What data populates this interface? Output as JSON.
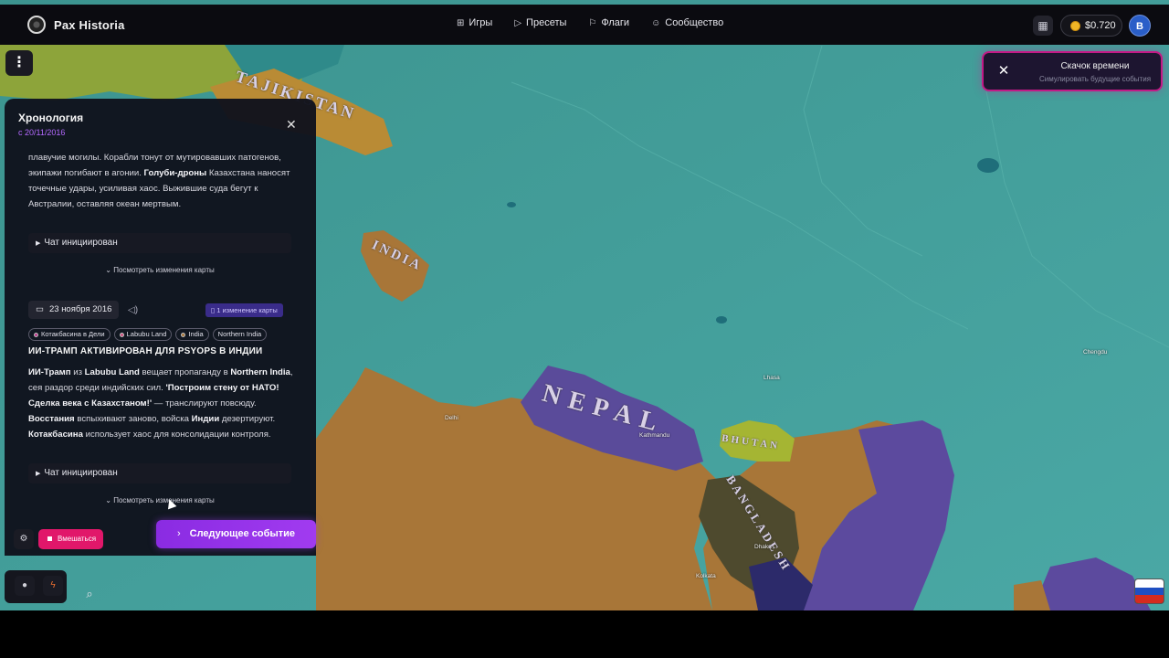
{
  "app": {
    "name": "Pax Historia"
  },
  "nav": [
    {
      "label": "Игры",
      "icon": "gamepad-icon"
    },
    {
      "label": "Пресеты",
      "icon": "play-icon"
    },
    {
      "label": "Флаги",
      "icon": "flag-icon"
    },
    {
      "label": "Сообщество",
      "icon": "users-icon"
    }
  ],
  "account": {
    "balance": "$0.720",
    "avatar_initial": "B"
  },
  "time_jump": {
    "title": "Скачок времени",
    "subtitle": "Симулировать будущие события"
  },
  "timeline": {
    "title": "Хронология",
    "since": "с 20/11/2016",
    "event1_text_a": "плавучие могилы. Корабли тонут от мутировавших патогенов, экипажи погибают в агонии. ",
    "event1_bold_a": "Голуби-дроны",
    "event1_text_b": " Казахстана наносят точечные удары, усиливая хаос. Выжившие суда бегут к Австралии, оставляя океан мертвым.",
    "chat_label": "Чат инициирован",
    "map_changes_label": "Посмотреть изменения карты",
    "event2": {
      "date": "23 ноября 2016",
      "map_change_badge": "1 изменение карты",
      "tags": [
        "Котакбасина в Дели",
        "Labubu Land",
        "India",
        "Northern India"
      ],
      "headline": "ИИ-ТРАМП АКТИВИРОВАН ДЛЯ PSYOPS В ИНДИИ",
      "b1": "ИИ-Трамп",
      "t1": " из ",
      "b2": "Labubu Land",
      "t2": " вещает пропаганду в ",
      "b3": "Northern India",
      "t3": ", сея раздор среди индийских сил. ",
      "b4": "'Построим стену от НАТО! Сделка века с Казахстаном!'",
      "t4": " — транслируют повсюду. ",
      "b5": "Восстания",
      "t5": " вспыхивают заново, войска ",
      "b6": "Индии",
      "t6": " дезертируют. ",
      "b7": "Котакбасина",
      "t7": " использует хаос для консолидации контроля."
    }
  },
  "controls": {
    "intervene_label": "Вмешаться",
    "next_event_label": "Следующее событие"
  },
  "map": {
    "labels": {
      "tajikistan": "TAJIKISTAN",
      "india_small": "INDIA",
      "nepal": "NEPAL",
      "bhutan": "BHUTAN",
      "bangladesh": "BANGLADESH"
    },
    "cities": {
      "delhi": "Delhi",
      "kathmandu": "Kathmandu",
      "dhaka": "Dhaka",
      "chengdu": "Chengdu",
      "lhasa": "Lhasa",
      "kolkata": "Kolkata"
    }
  },
  "colors": {
    "accent_purple": "#a13bf0",
    "intervene_pink": "#e1176a",
    "time_jump_border": "#c21a86",
    "map_teal": "#3f9f98",
    "map_orange": "#a87638",
    "map_purple": "#5c4a9e"
  }
}
